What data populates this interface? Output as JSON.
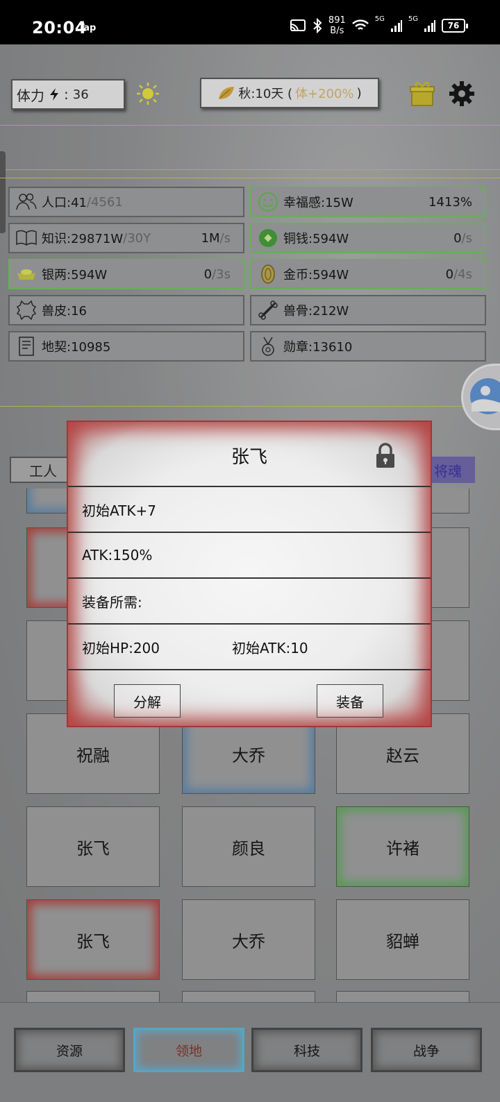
{
  "status_bar": {
    "time": "20:04",
    "carrier_tag": "Tap",
    "net_speed_value": "891",
    "net_speed_unit": "B/s",
    "signal1_label": "5G",
    "signal2_label": "5G",
    "battery": "76"
  },
  "top": {
    "stamina_label": "体力",
    "stamina_sep": ":",
    "stamina_value": "36",
    "season_text": "秋:10天 (",
    "season_bonus": "体+200%",
    "season_close": ")"
  },
  "resources": [
    {
      "name": "人口:41",
      "cap": "/4561",
      "rate": "",
      "rate_unit": "",
      "icon": "people-icon",
      "green": false
    },
    {
      "name": "幸福感:15W",
      "cap": "",
      "rate": "1413%",
      "rate_unit": "",
      "icon": "smile-icon",
      "green": true
    },
    {
      "name": "知识:29871W",
      "cap": "/30Y",
      "rate": "1M",
      "rate_unit": "/s",
      "icon": "book-icon",
      "green": false
    },
    {
      "name": "铜钱:594W",
      "cap": "",
      "rate": "0",
      "rate_unit": "/s",
      "icon": "copper-coin-icon",
      "green": true
    },
    {
      "name": "银两:594W",
      "cap": "",
      "rate": "0",
      "rate_unit": "/3s",
      "icon": "silver-ingot-icon",
      "green": true
    },
    {
      "name": "金币:594W",
      "cap": "",
      "rate": "0",
      "rate_unit": "/4s",
      "icon": "gold-coin-icon",
      "green": true
    },
    {
      "name": "兽皮:16",
      "cap": "",
      "rate": "",
      "rate_unit": "",
      "icon": "hide-icon",
      "green": false
    },
    {
      "name": "兽骨:212W",
      "cap": "",
      "rate": "",
      "rate_unit": "",
      "icon": "bone-icon",
      "green": false
    },
    {
      "name": "地契:10985",
      "cap": "",
      "rate": "",
      "rate_unit": "",
      "icon": "deed-icon",
      "green": false
    },
    {
      "name": "勋章:13610",
      "cap": "",
      "rate": "",
      "rate_unit": "",
      "icon": "medal-icon",
      "green": false
    }
  ],
  "tabs": {
    "worker": "工人",
    "soul": "将魂"
  },
  "heroes": [
    {
      "name": "祝融",
      "tier": "none"
    },
    {
      "name": "大乔",
      "tier": "blue"
    },
    {
      "name": "赵云",
      "tier": "none"
    },
    {
      "name": "张飞",
      "tier": "none"
    },
    {
      "name": "颜良",
      "tier": "none"
    },
    {
      "name": "许褚",
      "tier": "green"
    },
    {
      "name": "张飞",
      "tier": "red"
    },
    {
      "name": "大乔",
      "tier": "none"
    },
    {
      "name": "貂蝉",
      "tier": "none"
    }
  ],
  "dialog": {
    "title": "张飞",
    "row1": "初始ATK+7",
    "row2": "ATK:150%",
    "row3": "装备所需:",
    "row4_col1": "初始HP:200",
    "row4_col2": "初始ATK:10",
    "btn_decompose": "分解",
    "btn_equip": "装备"
  },
  "nav": {
    "resources": "资源",
    "territory": "领地",
    "tech": "科技",
    "war": "战争"
  },
  "colors": {
    "accent_blue": "#58b7d6",
    "rarity_red": "#b5433e",
    "rarity_green": "#5ea65a",
    "rarity_blue": "#5d86ad"
  }
}
